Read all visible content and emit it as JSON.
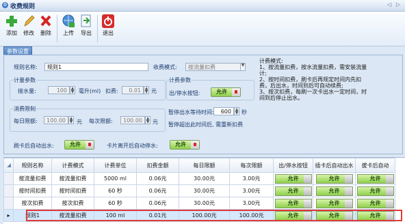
{
  "window": {
    "title": "收费规则",
    "controls": "◁ ▷"
  },
  "toolbar": {
    "add": "添加",
    "edit": "修改",
    "delete": "删除",
    "upload": "上传",
    "export": "导出",
    "exit": "退出"
  },
  "tab": {
    "label": "参数设置"
  },
  "form": {
    "rule_name_label": "规则名称:",
    "rule_name_value": "规则1",
    "mode_label": "收费模式:",
    "mode_value": "按流量扣费",
    "meter_group": "计量参数",
    "water_label": "接水量:",
    "water_value": "100",
    "liter_label": "毫升(ml)",
    "deduct_label": "扣费:",
    "deduct_value": "0.01",
    "yuan": "元",
    "calc_group": "计费参数",
    "out_btn_label": "出/停水按钮:",
    "allow": "允许",
    "limit_group": "消费限制",
    "daily_label": "每日限额:",
    "daily_value": "100.00",
    "per_label": "每次限额:",
    "per_value": "100.00",
    "pause_label": "暂停出水等待时间:",
    "pause_value": "600",
    "sec": "秒",
    "pause_note": "暂停超出此时间后, 需重新扣费",
    "auto_out_label": "刷卡后自动出水:",
    "auto_stop_label": "卡片离开后自动停水:",
    "notes": "计费模式:\n1、按流量扣费，按水流量扣费，需安装流量计;\n2、按时间扣费，刷卡后再规定时间内先扣费，后出水，时间到后可自动续费;\n3、按次扣费，每刷一次卡出水一定时间，时间到后停止出水。"
  },
  "grid": {
    "columns": [
      "规则名称",
      "计费模式",
      "计费单位",
      "扣费金额",
      "每日限额",
      "每次限额",
      "出/停水按钮",
      "插卡后自动出水",
      "拔卡后自动"
    ],
    "rows": [
      [
        "按流量扣费",
        "按流量扣费",
        "5000 ml",
        "0.06元",
        "30.00元",
        "3.00元"
      ],
      [
        "按时间扣费",
        "按时间扣费",
        "60 秒",
        "0.06元",
        "30.00元",
        "3.00元"
      ],
      [
        "按次扣费",
        "按次扣费",
        "60 秒",
        "0.06元",
        "30.00元",
        "3.00元"
      ],
      [
        "规则1",
        "按流量扣费",
        "100 ml",
        "0.01元",
        "100.00元",
        "100.00元"
      ]
    ],
    "allow": "允许"
  }
}
